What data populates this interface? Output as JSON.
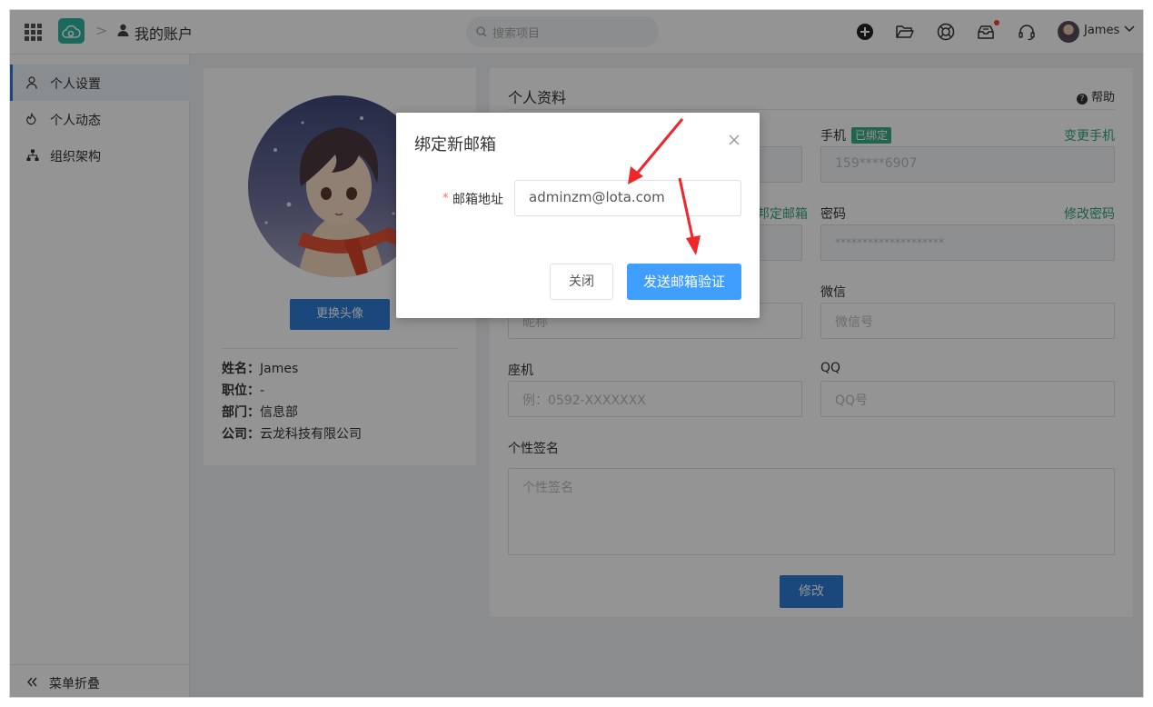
{
  "header": {
    "breadcrumb_separator": ">",
    "page_title": "我的账户",
    "search_placeholder": "搜索项目",
    "user_name": "James",
    "icons": [
      "apps-grid-icon",
      "cloud-logo",
      "user-icon",
      "search-icon",
      "add-circle-icon",
      "folder-open-icon",
      "lifebuoy-icon",
      "inbox-icon",
      "headset-icon",
      "chevron-down-icon"
    ]
  },
  "sidebar": {
    "items": [
      {
        "label": "个人设置",
        "icon": "user-outline-icon",
        "active": true
      },
      {
        "label": "个人动态",
        "icon": "activity-icon",
        "active": false
      },
      {
        "label": "组织架构",
        "icon": "org-chart-icon",
        "active": false
      }
    ],
    "collapse_label": "菜单折叠"
  },
  "profile": {
    "change_avatar": "更换头像",
    "rows": [
      {
        "label": "姓名：",
        "value": "James"
      },
      {
        "label": "职位：",
        "value": "-"
      },
      {
        "label": "部门：",
        "value": "信息部"
      },
      {
        "label": "公司：",
        "value": "云龙科技有限公司"
      }
    ]
  },
  "form": {
    "title": "个人资料",
    "help": "帮助",
    "mobile_label": "手机",
    "mobile_badge": "已绑定",
    "mobile_link": "变更手机",
    "mobile_value": "159****6907",
    "email_link_partial": "邦定邮箱",
    "password_label": "密码",
    "password_link": "修改密码",
    "password_value": "********************",
    "nickname_placeholder_partial": "昵称",
    "wechat_label": "微信",
    "wechat_placeholder": "微信号",
    "landline_label": "座机",
    "landline_placeholder": "例：0592-XXXXXXX",
    "qq_label": "QQ",
    "qq_placeholder": "QQ号",
    "signature_label": "个性签名",
    "signature_placeholder": "个性签名",
    "submit": "修改"
  },
  "modal": {
    "title": "绑定新邮箱",
    "required_mark": "*",
    "email_label": "邮箱地址",
    "email_value": "adminzm@lota.com",
    "close_button": "关闭",
    "send_button": "发送邮箱验证"
  },
  "colors": {
    "primary": "#2d7bd6",
    "modal_primary": "#409eff",
    "success": "#3bae83",
    "link_green": "#2fa57c",
    "danger": "#f56c6c",
    "annotation_arrow": "#f0262a"
  }
}
